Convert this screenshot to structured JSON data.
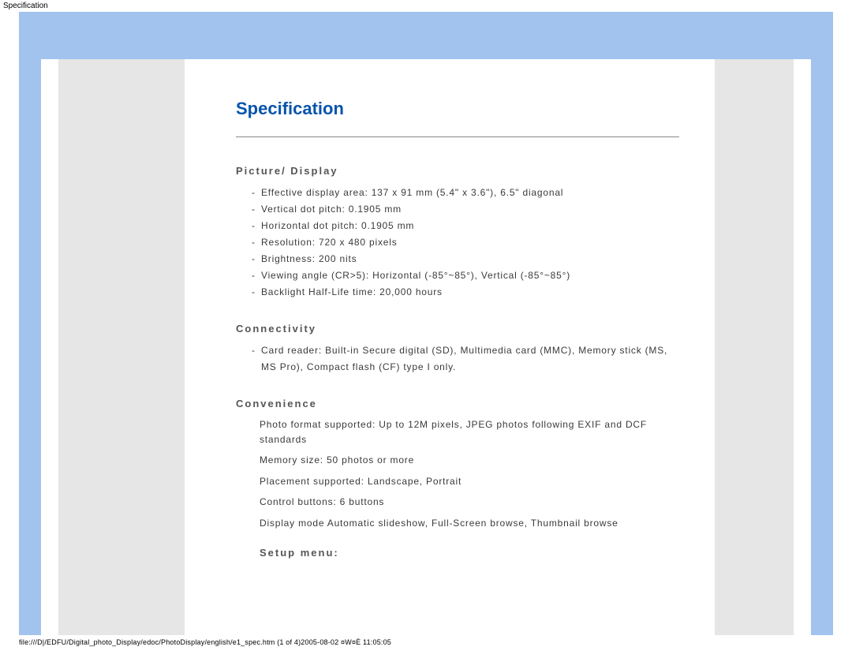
{
  "topLabel": "Specification",
  "heading": "Specification",
  "sections": {
    "pictureDisplay": {
      "title": "Picture/ Display",
      "items": [
        "Effective display area: 137 x 91 mm (5.4\" x 3.6\"), 6.5\" diagonal",
        "Vertical dot pitch: 0.1905 mm",
        "Horizontal dot pitch: 0.1905 mm",
        "Resolution: 720 x 480 pixels",
        "Brightness: 200 nits",
        "Viewing angle (CR>5): Horizontal (-85°~85°), Vertical (-85°~85°)",
        "Backlight Half-Life time: 20,000 hours"
      ]
    },
    "connectivity": {
      "title": "Connectivity",
      "items": [
        "Card reader: Built-in Secure digital (SD), Multimedia card (MMC), Memory stick (MS, MS Pro), Compact flash (CF) type I only."
      ]
    },
    "convenience": {
      "title": "Convenience",
      "items": [
        "Photo format supported: Up to 12M pixels, JPEG photos following EXIF and DCF standards",
        "Memory size: 50 photos or more",
        "Placement supported: Landscape, Portrait",
        "Control buttons: 6 buttons",
        "Display mode Automatic slideshow, Full-Screen browse, Thumbnail browse"
      ]
    },
    "setupMenu": {
      "title": "Setup menu:"
    }
  },
  "footerPath": "file:///D|/EDFU/Digital_photo_Display/edoc/PhotoDisplay/english/e1_spec.htm (1 of 4)2005-08-02 ¤W¤È 11:05:05"
}
